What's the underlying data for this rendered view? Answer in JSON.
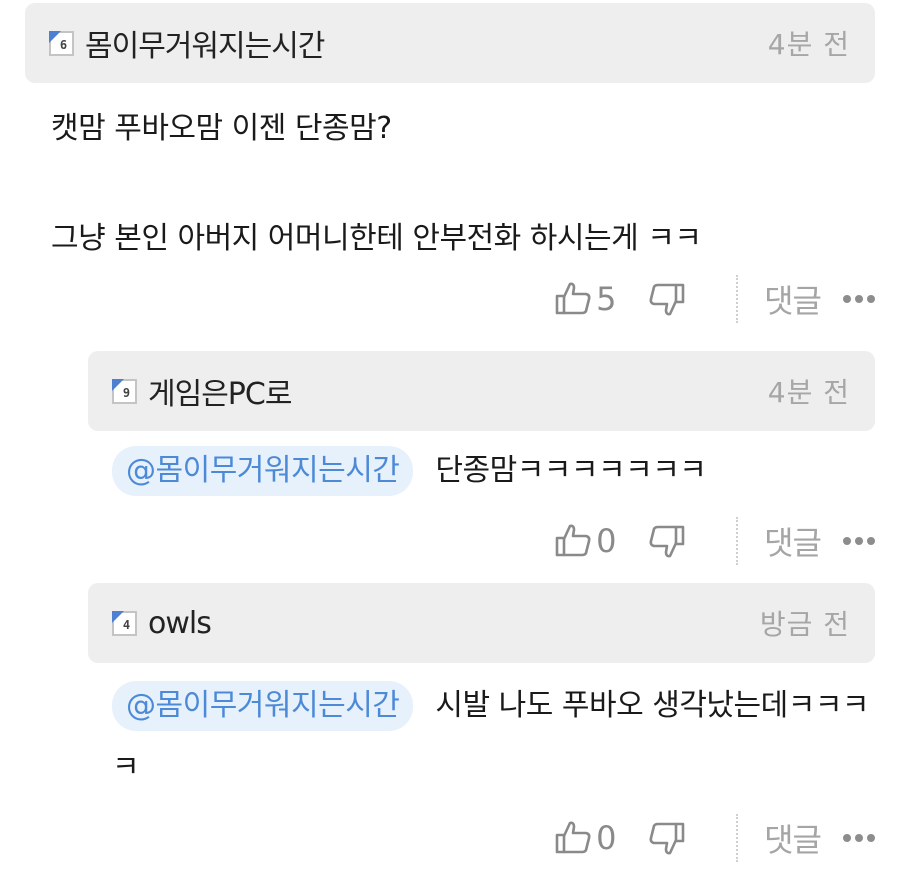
{
  "comments": [
    {
      "level": "6",
      "nickname": "몸이무거워지는시간",
      "time": "4분 전",
      "lines": [
        "캣맘 푸바오맘 이젠 단종맘?",
        "그냥 본인 아버지 어머니한테 안부전화 하시는게 ㅋㅋ"
      ],
      "likes": "5",
      "reply_label": "댓글"
    },
    {
      "level": "9",
      "nickname": "게임은PC로",
      "time": "4분 전",
      "mention": "@몸이무거워지는시간",
      "text": "단종맘ㅋㅋㅋㅋㅋㅋㅋ",
      "likes": "0",
      "reply_label": "댓글"
    },
    {
      "level": "4",
      "nickname": "owls",
      "time": "방금 전",
      "mention": "@몸이무거워지는시간",
      "text": "시발 나도 푸바오 생각났는데ㅋㅋㅋㅋ",
      "likes": "0",
      "reply_label": "댓글"
    }
  ],
  "colors": {
    "header_bg": "#eeeeee",
    "mention_bg": "#e7f1fb",
    "mention_text": "#4c8ad8",
    "level_badge": "#4f7fd1",
    "muted": "#a6a6a6"
  },
  "icons": [
    "thumbs-up-icon",
    "thumbs-down-icon",
    "more-icon"
  ]
}
